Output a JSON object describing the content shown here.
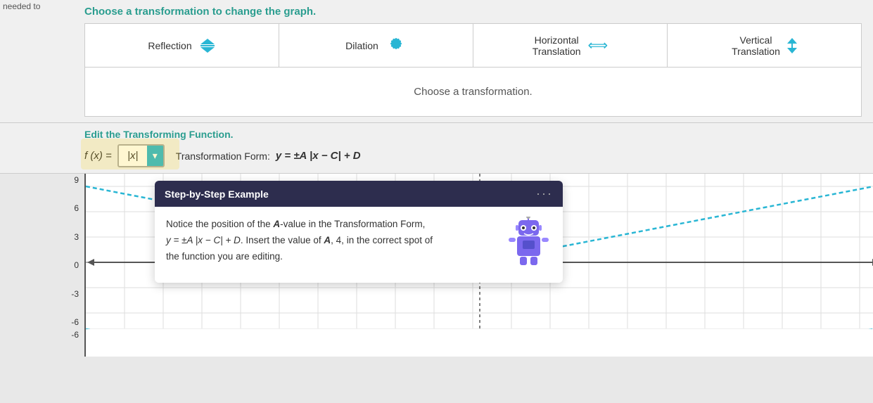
{
  "needed_to": "needed to",
  "top": {
    "choose_title": "Choose a transformation to change the graph.",
    "cards": [
      {
        "id": "reflection",
        "label": "Reflection",
        "icon_type": "reflect"
      },
      {
        "id": "dilation",
        "label": "Dilation",
        "icon_type": "dilation"
      },
      {
        "id": "horizontal-translation",
        "label1": "Horizontal",
        "label2": "Translation",
        "icon_type": "horiz"
      },
      {
        "id": "vertical-translation",
        "label1": "Vertical",
        "label2": "Translation",
        "icon_type": "vert"
      }
    ],
    "choose_placeholder": "Choose a transformation."
  },
  "edit": {
    "title": "Edit the Transforming Function.",
    "fx": "f (x) =",
    "input_value": "|x|",
    "dropdown_symbol": "▾",
    "transformation_form_label": "Transformation Form:",
    "transformation_form_value": "y = ±A |x − C| + D"
  },
  "tooltip": {
    "header": "Step-by-Step Example",
    "dots": "···",
    "body_line1": "Notice the position of the ",
    "a_value": "A",
    "body_line2": "-value in the Transformation Form,",
    "formula": "y = ±A |x − C| + D",
    "body_line3": ". Insert the value of ",
    "a_val2": "A",
    "comma_4": ", 4,",
    "body_line4": " in the correct spot of",
    "body_line5": "the function you are editing."
  },
  "graph": {
    "y_labels": [
      "9",
      "6",
      "3",
      "0",
      "-3",
      "-6"
    ],
    "accent_color": "#29b6d4"
  }
}
